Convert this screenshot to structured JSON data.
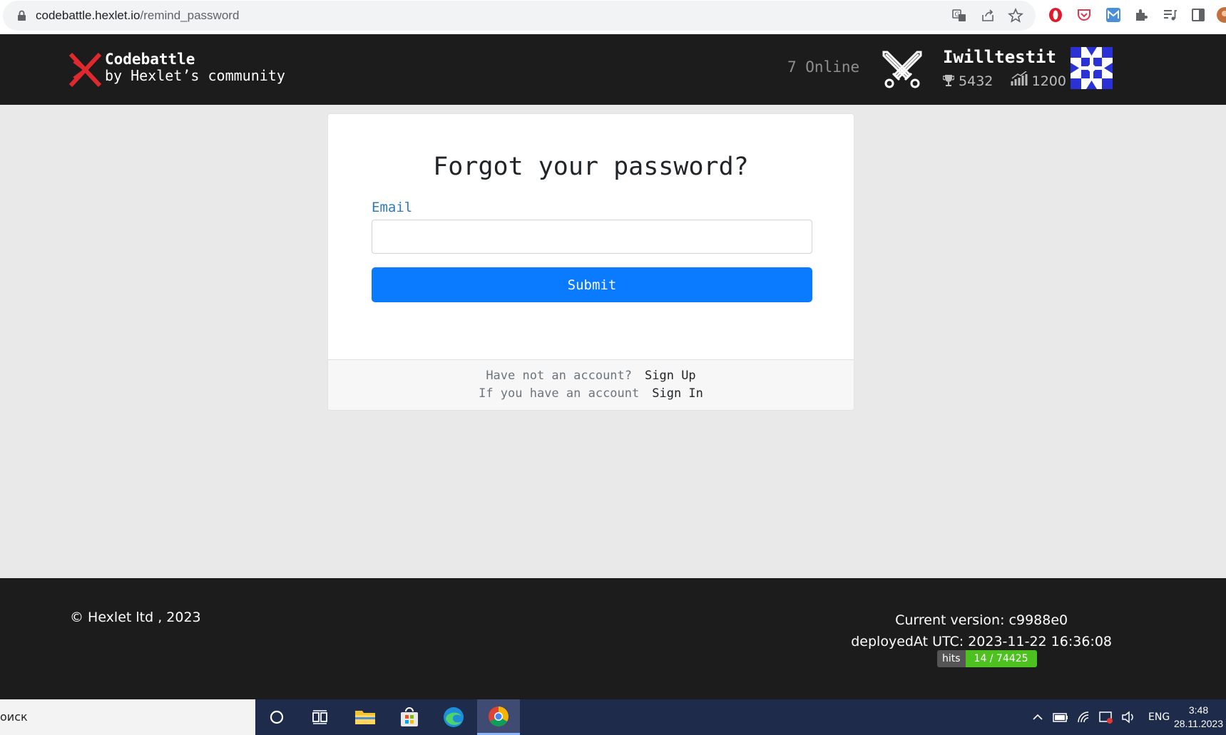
{
  "browser": {
    "url_domain": "codebattle.hexlet.io",
    "url_path": "/remind_password"
  },
  "header": {
    "brand_line1": "Codebattle",
    "brand_line2": "by Hexlet’s community",
    "online_text": "7 Online",
    "username": "Iwilltestit",
    "trophies": "5432",
    "rating": "1200"
  },
  "form": {
    "title": "Forgot your password?",
    "email_label": "Email",
    "email_value": "",
    "submit_label": "Submit",
    "signup_prompt": "Have not an account?",
    "signup_link": "Sign Up",
    "signin_prompt": "If you have an account",
    "signin_link": "Sign In"
  },
  "footer": {
    "copyright": "© Hexlet ltd , 2023",
    "version": "Current version: c9988e0",
    "deployed": "deployedAt UTC: 2023-11-22 16:36:08",
    "hits_label": "hits",
    "hits_value": "14 / 74425"
  },
  "taskbar": {
    "search_text": "оиск",
    "language": "ENG",
    "time": "3:48",
    "date": "28.11.2023"
  },
  "colors": {
    "primary": "#0a7bff",
    "navbar": "#1c1c1c",
    "logo_red": "#e0282f",
    "hits_green": "#4cc11f"
  }
}
